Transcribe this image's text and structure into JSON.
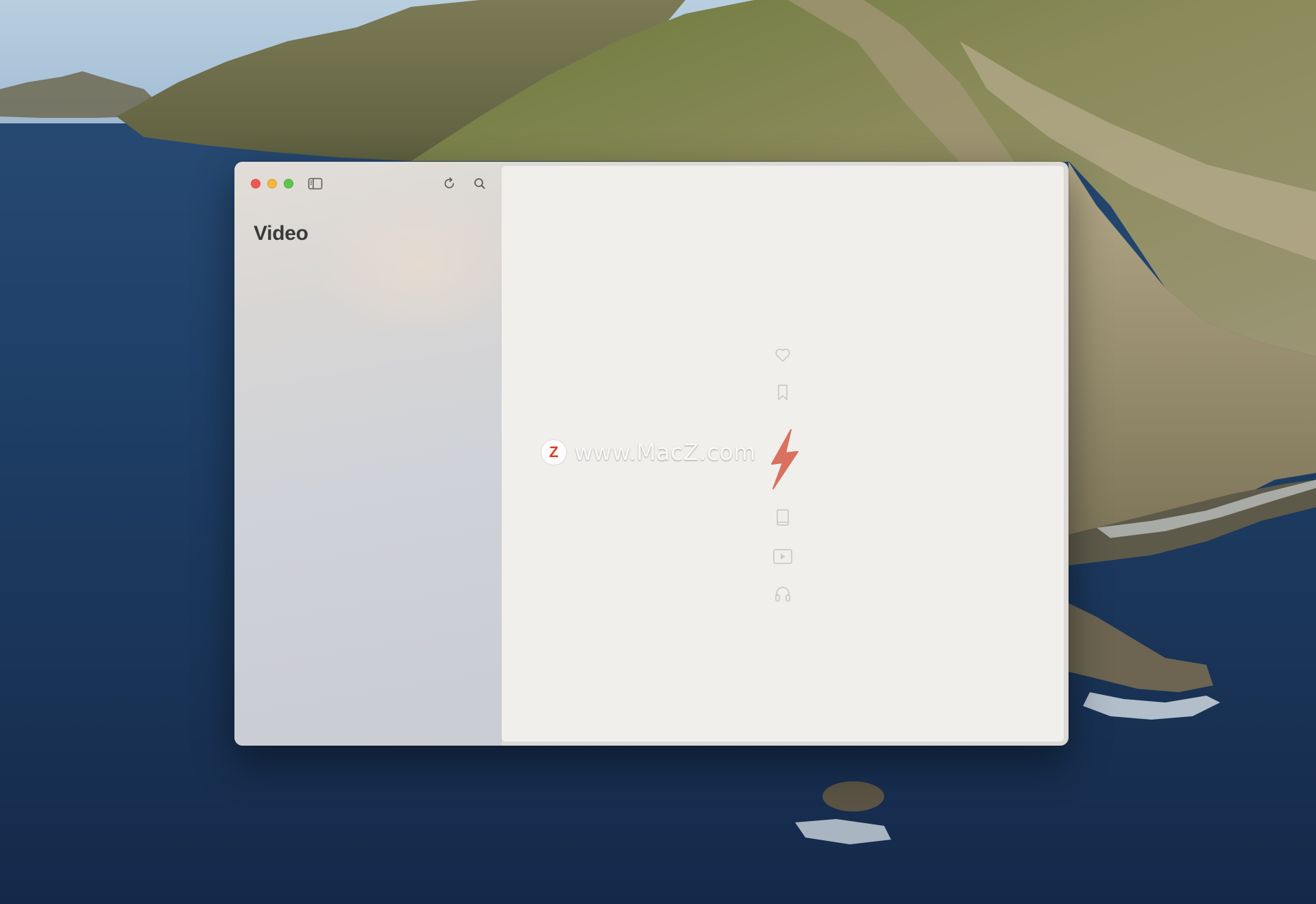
{
  "window": {
    "controls": [
      "close",
      "minimize",
      "zoom"
    ]
  },
  "toolbar": {
    "icons": [
      "sidebar-toggle-icon",
      "refresh-icon",
      "search-icon"
    ]
  },
  "sidebar": {
    "title": "Video"
  },
  "empty_state": {
    "icons": [
      "heart-icon",
      "bookmark-icon",
      "bolt-icon",
      "book-icon",
      "play-icon",
      "headphones-icon"
    ],
    "accent_color": "#d9715e",
    "icon_color": "#cdcac6"
  },
  "watermark": {
    "badge": "Z",
    "text": "www.MacZ.com"
  }
}
